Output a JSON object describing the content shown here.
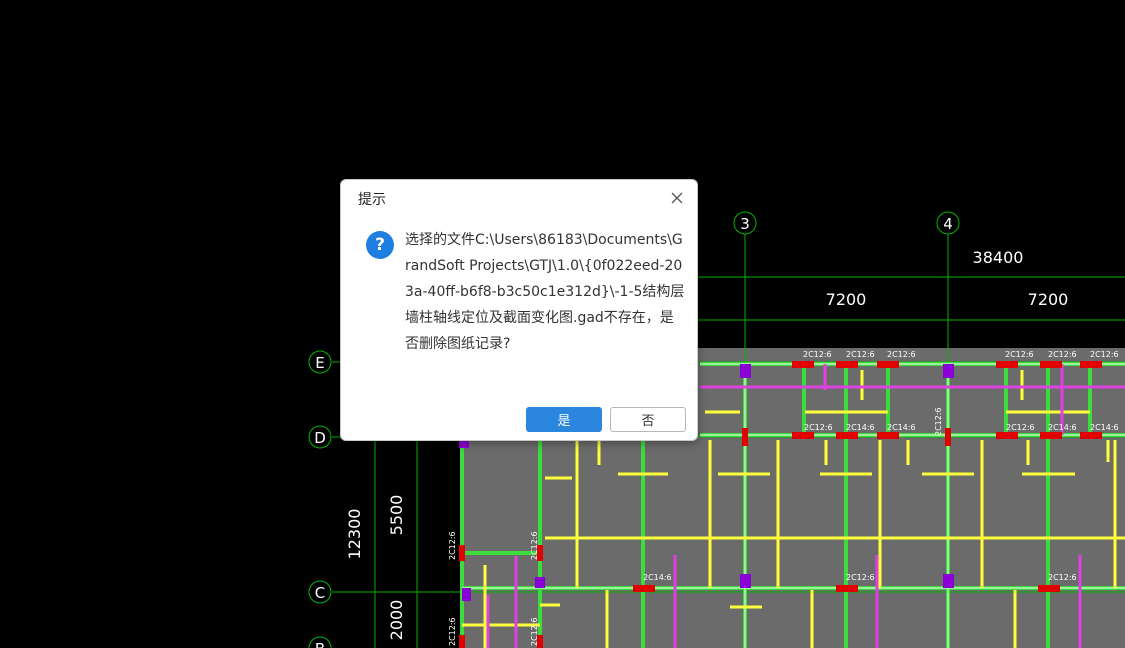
{
  "dialog": {
    "title": "提示",
    "icon": "question-icon",
    "message": "选择的文件C:\\Users\\86183\\Documents\\GrandSoft Projects\\GTJ\\1.0\\{0f022eed-203a-40ff-b6f8-b3c50c1e312d}\\-1-5结构层墙柱轴线定位及截面变化图.gad不存在，是否删除图纸记录?",
    "yes_label": "是",
    "no_label": "否",
    "close_icon": "close-icon"
  },
  "drawing": {
    "axis_labels": [
      "3",
      "4",
      "E",
      "D",
      "C",
      "B"
    ],
    "dimensions": [
      "38400",
      "7200",
      "7200",
      "12300",
      "5500",
      "2000"
    ],
    "rebar_labels": [
      "2C12:6",
      "2C12:6",
      "2C12:6",
      "2C12:6",
      "2C12:6",
      "2C12:6",
      "2C12:6",
      "2C14:6",
      "2C14:6",
      "2C14:6",
      "2C14:6",
      "2C12:6",
      "2C14:6",
      "2C12:6",
      "2C12:6",
      "2C12:6",
      "2C12:6",
      "2C12:6",
      "2C12:6",
      "2C12:6"
    ],
    "colors": {
      "background": "#000000",
      "slab": "#6b6b6b",
      "axis": "#00c800",
      "beam_green": "#3ddc3d",
      "beam_yellow": "#ffff3c",
      "beam_magenta": "#e040e0",
      "column": "#8a00d6",
      "node": "#e00000"
    }
  }
}
